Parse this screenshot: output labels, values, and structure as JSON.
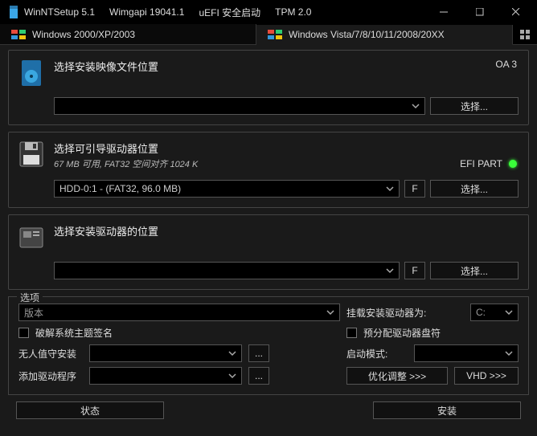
{
  "title": {
    "app": "WinNTSetup 5.1",
    "wimgapi": "Wimgapi 19041.1",
    "uefi": "uEFI 安全启动",
    "tpm": "TPM 2.0"
  },
  "tabs": {
    "legacy": "Windows 2000/XP/2003",
    "modern": "Windows Vista/7/8/10/11/2008/20XX"
  },
  "section1": {
    "title": "选择安装映像文件位置",
    "badge": "OA 3",
    "select_btn": "选择..."
  },
  "section2": {
    "title": "选择可引导驱动器位置",
    "sub": "67 MB 可用, FAT32 空间对齐 1024 K",
    "badge": "EFI PART",
    "combo": "HDD-0:1 -   (FAT32, 96.0 MB)",
    "f_btn": "F",
    "select_btn": "选择..."
  },
  "section3": {
    "title": "选择安装驱动器的位置",
    "f_btn": "F",
    "select_btn": "选择..."
  },
  "options": {
    "legend": "选项",
    "version_placeholder": "版本",
    "mount_label": "挂载安装驱动器为:",
    "mount_value": "C:",
    "crack_theme": "破解系统主题签名",
    "prealloc": "预分配驱动器盘符",
    "unattended": "无人值守安装",
    "boot_mode": "启动模式:",
    "add_driver": "添加驱动程序",
    "tune_btn": "优化调整 >>>",
    "vhd_btn": "VHD  >>>",
    "dots": "..."
  },
  "footer": {
    "status": "状态",
    "install": "安装"
  }
}
